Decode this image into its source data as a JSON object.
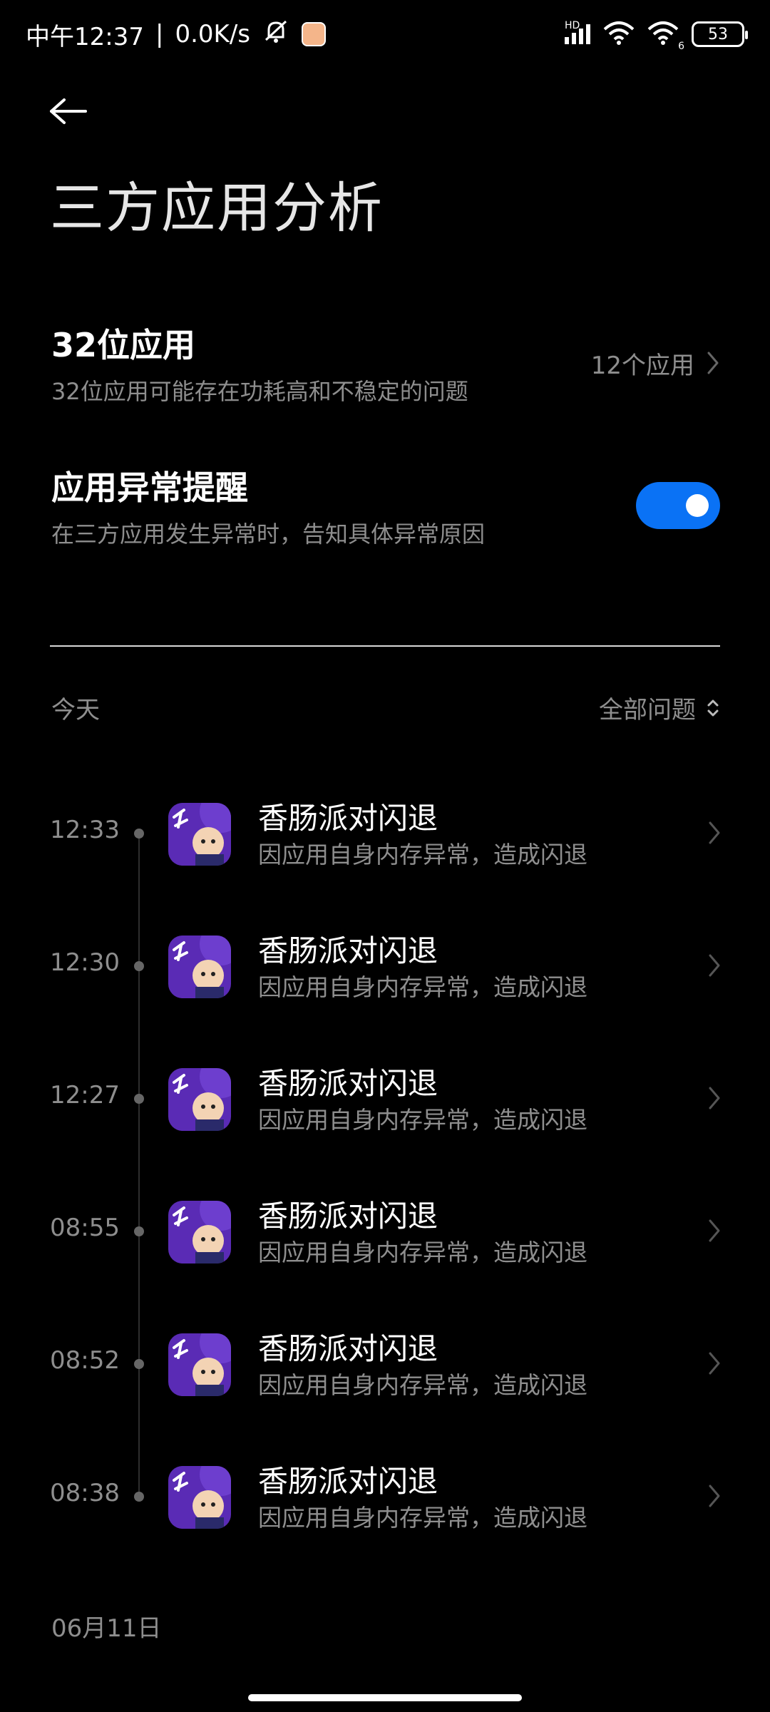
{
  "status_bar": {
    "time": "中午12:37",
    "network_speed": "0.0K/s",
    "battery": "53",
    "hd_label": "HD",
    "wifi_badge": "6",
    "icons": [
      "mute-icon",
      "app-notification-icon",
      "hd-signal-icon",
      "wifi-icon",
      "wifi6-icon",
      "battery-icon"
    ]
  },
  "header": {
    "back_icon": "arrow-left-icon",
    "title": "三方应用分析"
  },
  "settings": {
    "apps_32bit": {
      "title": "32位应用",
      "description": "32位应用可能存在功耗高和不稳定的问题",
      "value": "12个应用"
    },
    "crash_alert": {
      "title": "应用异常提醒",
      "description": "在三方应用发生异常时，告知具体异常原因",
      "enabled": true
    }
  },
  "section": {
    "day_label": "今天",
    "filter_label": "全部问题"
  },
  "entries": [
    {
      "time": "12:33",
      "title": "香肠派对闪退",
      "description": "因应用自身内存异常，造成闪退"
    },
    {
      "time": "12:30",
      "title": "香肠派对闪退",
      "description": "因应用自身内存异常，造成闪退"
    },
    {
      "time": "12:27",
      "title": "香肠派对闪退",
      "description": "因应用自身内存异常，造成闪退"
    },
    {
      "time": "08:55",
      "title": "香肠派对闪退",
      "description": "因应用自身内存异常，造成闪退"
    },
    {
      "time": "08:52",
      "title": "香肠派对闪退",
      "description": "因应用自身内存异常，造成闪退"
    },
    {
      "time": "08:38",
      "title": "香肠派对闪退",
      "description": "因应用自身内存异常，造成闪退"
    }
  ],
  "next_date_label": "06月11日",
  "colors": {
    "accent": "#0a72f5",
    "background": "#000000",
    "secondary_text": "#8e8e8e",
    "app_icon_purple": "#5a2bb5"
  }
}
